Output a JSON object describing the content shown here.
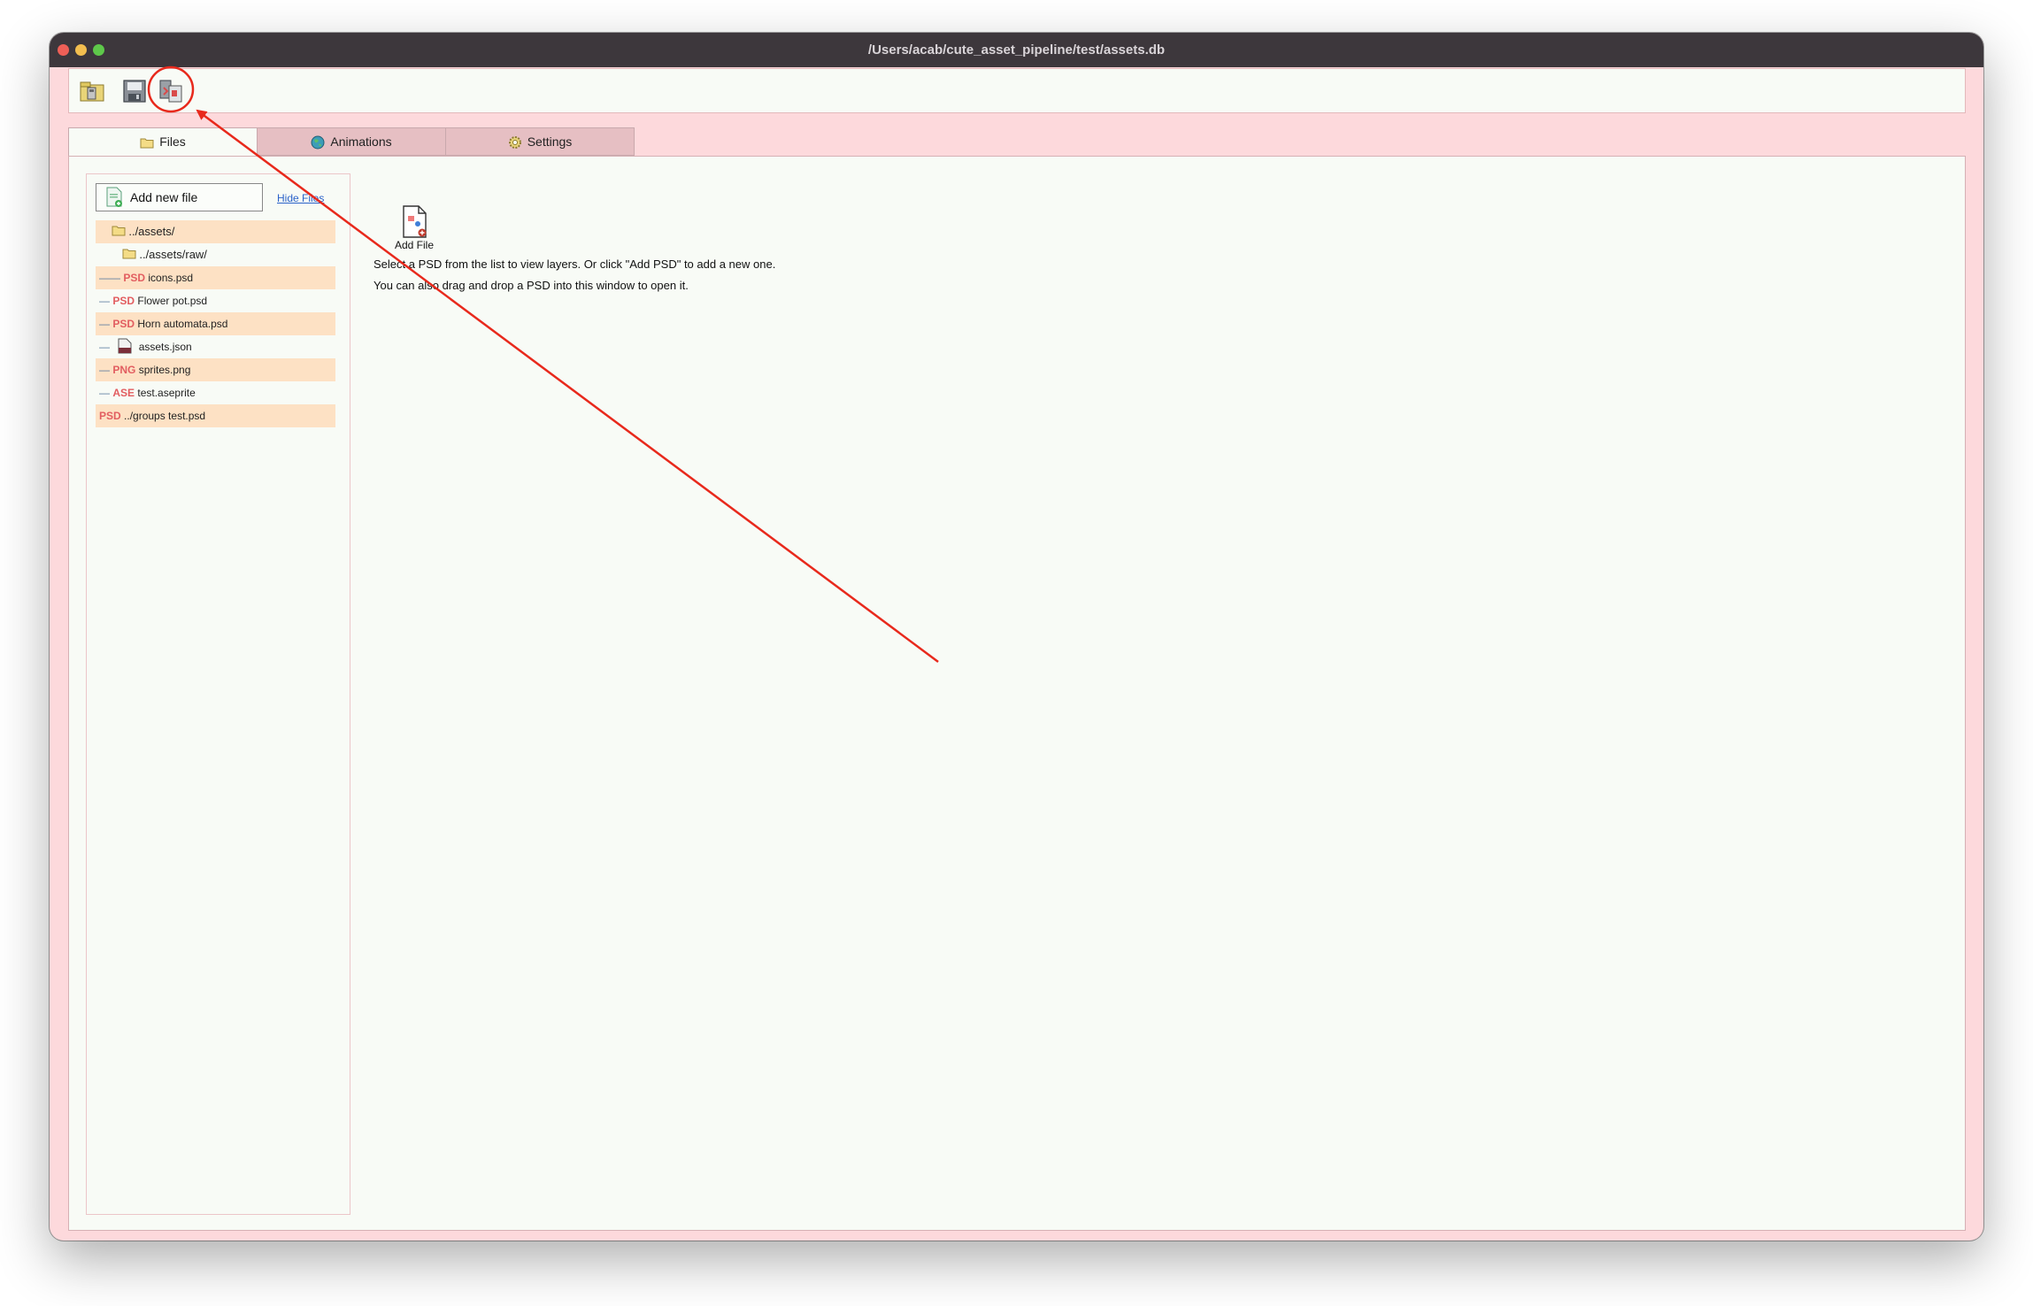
{
  "window": {
    "title": "/Users/acab/cute_asset_pipeline/test/assets.db"
  },
  "toolbar": {
    "buttons": [
      {
        "icon": "open-project-icon"
      },
      {
        "icon": "save-icon"
      },
      {
        "icon": "export-icon"
      }
    ]
  },
  "tabs": [
    {
      "label": "Files",
      "icon": "folder-icon",
      "active": true
    },
    {
      "label": "Animations",
      "icon": "globe-icon",
      "active": false
    },
    {
      "label": "Settings",
      "icon": "gear-icon",
      "active": false
    }
  ],
  "sidebar": {
    "add_button_label": "Add new file",
    "hide_link": "Hide Files",
    "items": [
      {
        "prefix": "",
        "tag": "",
        "name": "../assets/",
        "kind": "folder"
      },
      {
        "prefix": "",
        "tag": "",
        "name": "../assets/raw/",
        "kind": "folder"
      },
      {
        "prefix": "——",
        "tag": "PSD",
        "name": "icons.psd",
        "kind": "file"
      },
      {
        "prefix": "—",
        "tag": "PSD",
        "name": "Flower pot.psd",
        "kind": "file"
      },
      {
        "prefix": "—",
        "tag": "PSD",
        "name": "Horn automata.psd",
        "kind": "file"
      },
      {
        "prefix": "—",
        "tag": "",
        "name": "assets.json",
        "kind": "json"
      },
      {
        "prefix": "—",
        "tag": "PNG",
        "name": "sprites.png",
        "kind": "file"
      },
      {
        "prefix": "—",
        "tag": "ASE",
        "name": "test.aseprite",
        "kind": "file"
      },
      {
        "prefix": "",
        "tag": "PSD",
        "name": "../groups test.psd",
        "kind": "file"
      }
    ]
  },
  "main": {
    "add_file_label": "Add File",
    "message_line1": "Select a PSD from the list to view layers. Or click \"Add PSD\" to add a new one.",
    "message_line2": "You can also drag and drop a PSD into this window to open it."
  },
  "colors": {
    "accent": "#fdd9dc",
    "titlebar": "#3d373c",
    "highlight_row": "#fde1c4",
    "tag": "#e25d60",
    "annotation": "#e8291c"
  }
}
